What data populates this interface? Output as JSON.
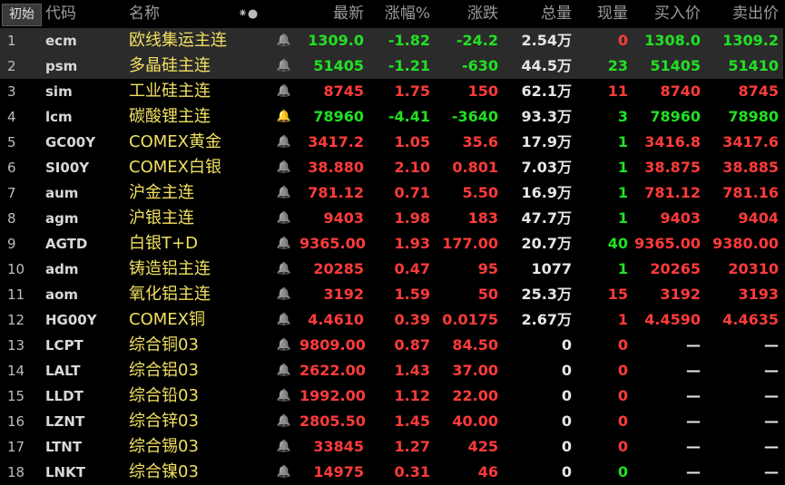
{
  "header": {
    "init_button": "初始",
    "columns": {
      "code": "代码",
      "name": "名称",
      "icon": "⁕●",
      "last": "最新",
      "pct": "涨幅%",
      "chg": "涨跌",
      "vol": "总量",
      "cur": "现量",
      "bid": "买入价",
      "ask": "卖出价"
    }
  },
  "colors": {
    "up": "#ff3b3b",
    "down": "#22e022",
    "name": "#f0e060",
    "selected_row_bg": "#2b2b2b"
  },
  "rows": [
    {
      "idx": "1",
      "code": "ecm",
      "name": "欧线集运主连",
      "last": "1309.0",
      "pct": "-1.82",
      "chg": "-24.2",
      "vol": "2.54万",
      "cur": "0",
      "bid": "1308.0",
      "ask": "1309.2",
      "dir": "down",
      "cur_dir": "up",
      "selected": true,
      "bell": "normal"
    },
    {
      "idx": "2",
      "code": "psm",
      "name": "多晶硅主连",
      "last": "51405",
      "pct": "-1.21",
      "chg": "-630",
      "vol": "44.5万",
      "cur": "23",
      "bid": "51405",
      "ask": "51410",
      "dir": "down",
      "cur_dir": "down",
      "selected": true,
      "bell": "normal"
    },
    {
      "idx": "3",
      "code": "sim",
      "name": "工业硅主连",
      "last": "8745",
      "pct": "1.75",
      "chg": "150",
      "vol": "62.1万",
      "cur": "11",
      "bid": "8740",
      "ask": "8745",
      "dir": "up",
      "cur_dir": "up",
      "bell": "normal"
    },
    {
      "idx": "4",
      "code": "lcm",
      "name": "碳酸锂主连",
      "last": "78960",
      "pct": "-4.41",
      "chg": "-3640",
      "vol": "93.3万",
      "cur": "3",
      "bid": "78960",
      "ask": "78980",
      "dir": "down",
      "cur_dir": "down",
      "bell": "active"
    },
    {
      "idx": "5",
      "code": "GC00Y",
      "name": "COMEX黄金",
      "last": "3417.2",
      "pct": "1.05",
      "chg": "35.6",
      "vol": "17.9万",
      "cur": "1",
      "bid": "3416.8",
      "ask": "3417.6",
      "dir": "up",
      "cur_dir": "down",
      "bell": "normal"
    },
    {
      "idx": "6",
      "code": "SI00Y",
      "name": "COMEX白银",
      "last": "38.880",
      "pct": "2.10",
      "chg": "0.801",
      "vol": "7.03万",
      "cur": "1",
      "bid": "38.875",
      "ask": "38.885",
      "dir": "up",
      "cur_dir": "down",
      "bell": "normal"
    },
    {
      "idx": "7",
      "code": "aum",
      "name": "沪金主连",
      "last": "781.12",
      "pct": "0.71",
      "chg": "5.50",
      "vol": "16.9万",
      "cur": "1",
      "bid": "781.12",
      "ask": "781.16",
      "dir": "up",
      "cur_dir": "down",
      "bell": "normal"
    },
    {
      "idx": "8",
      "code": "agm",
      "name": "沪银主连",
      "last": "9403",
      "pct": "1.98",
      "chg": "183",
      "vol": "47.7万",
      "cur": "1",
      "bid": "9403",
      "ask": "9404",
      "dir": "up",
      "cur_dir": "down",
      "bell": "normal"
    },
    {
      "idx": "9",
      "code": "AGTD",
      "name": "白银T+D",
      "last": "9365.00",
      "pct": "1.93",
      "chg": "177.00",
      "vol": "20.7万",
      "cur": "40",
      "bid": "9365.00",
      "ask": "9380.00",
      "dir": "up",
      "cur_dir": "down",
      "bell": "normal"
    },
    {
      "idx": "10",
      "code": "adm",
      "name": "铸造铝主连",
      "last": "20285",
      "pct": "0.47",
      "chg": "95",
      "vol": "1077",
      "cur": "1",
      "bid": "20265",
      "ask": "20310",
      "dir": "up",
      "cur_dir": "down",
      "bell": "normal"
    },
    {
      "idx": "11",
      "code": "aom",
      "name": "氧化铝主连",
      "last": "3192",
      "pct": "1.59",
      "chg": "50",
      "vol": "25.3万",
      "cur": "15",
      "bid": "3192",
      "ask": "3193",
      "dir": "up",
      "cur_dir": "up",
      "bell": "normal"
    },
    {
      "idx": "12",
      "code": "HG00Y",
      "name": "COMEX铜",
      "last": "4.4610",
      "pct": "0.39",
      "chg": "0.0175",
      "vol": "2.67万",
      "cur": "1",
      "bid": "4.4590",
      "ask": "4.4635",
      "dir": "up",
      "cur_dir": "up",
      "bell": "normal"
    },
    {
      "idx": "13",
      "code": "LCPT",
      "name": "综合铜03",
      "last": "9809.00",
      "pct": "0.87",
      "chg": "84.50",
      "vol": "0",
      "cur": "0",
      "bid": "—",
      "ask": "—",
      "dir": "up",
      "cur_dir": "up",
      "bell": "normal"
    },
    {
      "idx": "14",
      "code": "LALT",
      "name": "综合铝03",
      "last": "2622.00",
      "pct": "1.43",
      "chg": "37.00",
      "vol": "0",
      "cur": "0",
      "bid": "—",
      "ask": "—",
      "dir": "up",
      "cur_dir": "up",
      "bell": "normal"
    },
    {
      "idx": "15",
      "code": "LLDT",
      "name": "综合铅03",
      "last": "1992.00",
      "pct": "1.12",
      "chg": "22.00",
      "vol": "0",
      "cur": "0",
      "bid": "—",
      "ask": "—",
      "dir": "up",
      "cur_dir": "up",
      "bell": "normal"
    },
    {
      "idx": "16",
      "code": "LZNT",
      "name": "综合锌03",
      "last": "2805.50",
      "pct": "1.45",
      "chg": "40.00",
      "vol": "0",
      "cur": "0",
      "bid": "—",
      "ask": "—",
      "dir": "up",
      "cur_dir": "up",
      "bell": "normal"
    },
    {
      "idx": "17",
      "code": "LTNT",
      "name": "综合锡03",
      "last": "33845",
      "pct": "1.27",
      "chg": "425",
      "vol": "0",
      "cur": "0",
      "bid": "—",
      "ask": "—",
      "dir": "up",
      "cur_dir": "up",
      "bell": "normal"
    },
    {
      "idx": "18",
      "code": "LNKT",
      "name": "综合镍03",
      "last": "14975",
      "pct": "0.31",
      "chg": "46",
      "vol": "0",
      "cur": "0",
      "bid": "—",
      "ask": "—",
      "dir": "up",
      "cur_dir": "down",
      "bell": "normal"
    }
  ]
}
